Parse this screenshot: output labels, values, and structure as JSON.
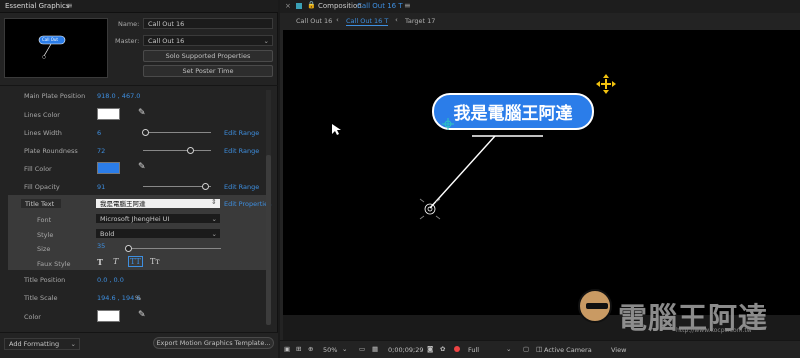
{
  "left_panel": {
    "title": "Essential Graphics",
    "name_label": "Name:",
    "name_value": "Call Out 16",
    "master_label": "Master:",
    "master_value": "Call Out 16",
    "solo_button": "Solo Supported Properties",
    "poster_button": "Set Poster Time",
    "thumbnail_text": "Call Out",
    "properties": {
      "main_plate_position": {
        "label": "Main Plate Position",
        "value": "918.0 , 467.0"
      },
      "lines_color": {
        "label": "Lines Color",
        "color": "#ffffff"
      },
      "lines_width": {
        "label": "Lines Width",
        "value": "6",
        "link": "Edit Range"
      },
      "plate_roundness": {
        "label": "Plate Roundness",
        "value": "72",
        "link": "Edit Range"
      },
      "fill_color": {
        "label": "Fill Color",
        "color": "#2b7de9"
      },
      "fill_opacity": {
        "label": "Fill Opacity",
        "value": "91",
        "link": "Edit Range"
      },
      "title_text": {
        "label": "Title Text",
        "value": "我是電腦王阿達",
        "link": "Edit Properties"
      },
      "font": {
        "label": "Font",
        "value": "Microsoft JhengHei UI"
      },
      "style": {
        "label": "Style",
        "value": "Bold"
      },
      "size": {
        "label": "Size",
        "value": "35"
      },
      "faux_style": {
        "label": "Faux Style",
        "buttons": [
          "T",
          "T",
          "TT",
          "Tт"
        ]
      },
      "title_position": {
        "label": "Title Position",
        "value": "0.0 , 0.0"
      },
      "title_scale": {
        "label": "Title Scale",
        "value": "194.6 , 194.6",
        "unit": "%"
      },
      "color": {
        "label": "Color",
        "color": "#ffffff"
      }
    },
    "add_formatting": "Add Formatting",
    "export_button": "Export Motion Graphics Template..."
  },
  "composition": {
    "tab_label": "Composition",
    "tab_name": "Call Out 16 T",
    "crumbs": [
      "Call Out 16",
      "Call Out 16 T",
      "Target 17"
    ],
    "callout_text": "我是電腦王阿達",
    "zoom": "50%",
    "timecode": "0;00;09;29",
    "resolution": "Full",
    "camera": "Active Camera",
    "view": "View"
  },
  "watermark": {
    "text": "電腦王阿達",
    "url": "http://www.kocpc.com.tw"
  },
  "colors": {
    "accent": "#3e8fe0",
    "callout_fill": "#2b7de9"
  }
}
